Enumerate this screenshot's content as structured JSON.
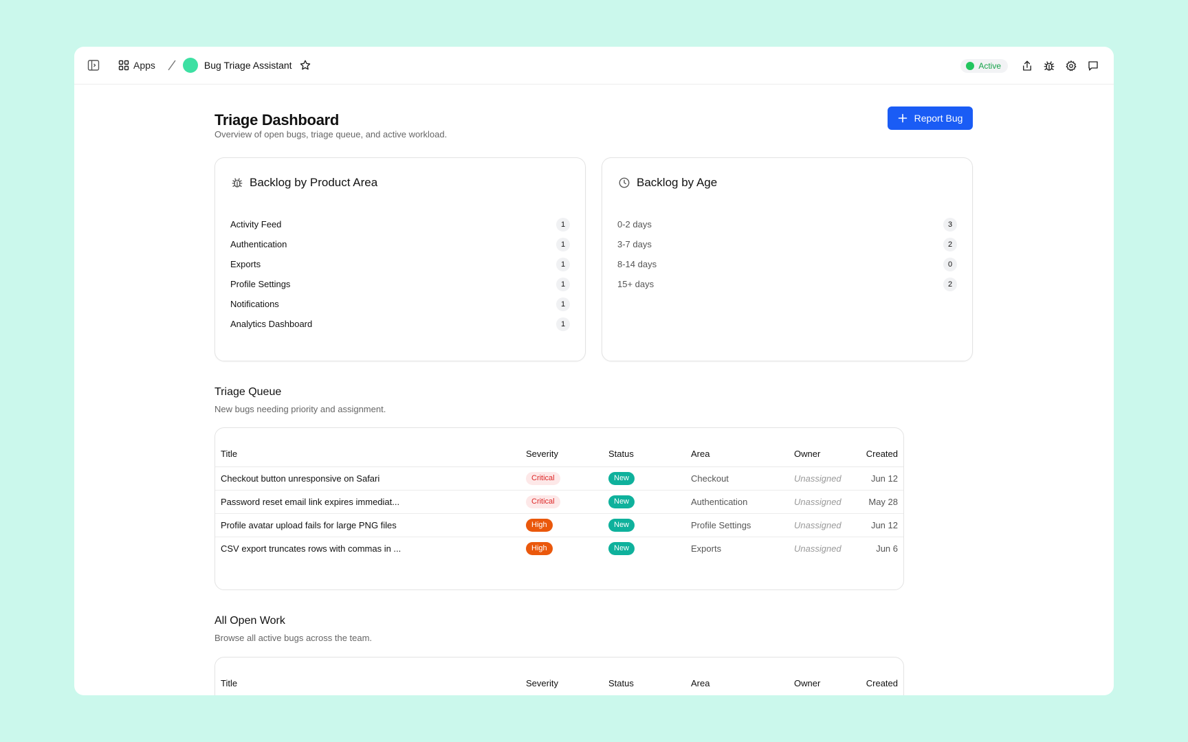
{
  "topbar": {
    "apps_label": "Apps",
    "app_name": "Bug Triage Assistant",
    "status_label": "Active"
  },
  "header": {
    "title": "Triage Dashboard",
    "subtitle": "Overview of open bugs, triage queue, and active workload.",
    "report_button": "Report Bug"
  },
  "backlog_area": {
    "title": "Backlog by Product Area",
    "items": [
      {
        "label": "Activity Feed",
        "count": "1"
      },
      {
        "label": "Authentication",
        "count": "1"
      },
      {
        "label": "Exports",
        "count": "1"
      },
      {
        "label": "Profile Settings",
        "count": "1"
      },
      {
        "label": "Notifications",
        "count": "1"
      },
      {
        "label": "Analytics Dashboard",
        "count": "1"
      }
    ]
  },
  "backlog_age": {
    "title": "Backlog by Age",
    "items": [
      {
        "label": "0-2 days",
        "count": "3"
      },
      {
        "label": "3-7 days",
        "count": "2"
      },
      {
        "label": "8-14 days",
        "count": "0"
      },
      {
        "label": "15+ days",
        "count": "2"
      }
    ]
  },
  "table_headers": {
    "title": "Title",
    "severity": "Severity",
    "status": "Status",
    "area": "Area",
    "owner": "Owner",
    "created": "Created"
  },
  "triage_queue": {
    "title": "Triage Queue",
    "subtitle": "New bugs needing priority and assignment.",
    "rows": [
      {
        "title": "Checkout button unresponsive on Safari",
        "severity": "Critical",
        "status": "New",
        "area": "Checkout",
        "owner": "Unassigned",
        "created": "Jun 12"
      },
      {
        "title": "Password reset email link expires immediat...",
        "severity": "Critical",
        "status": "New",
        "area": "Authentication",
        "owner": "Unassigned",
        "created": "May 28"
      },
      {
        "title": "Profile avatar upload fails for large PNG files",
        "severity": "High",
        "status": "New",
        "area": "Profile Settings",
        "owner": "Unassigned",
        "created": "Jun 12"
      },
      {
        "title": "CSV export truncates rows with commas in ...",
        "severity": "High",
        "status": "New",
        "area": "Exports",
        "owner": "Unassigned",
        "created": "Jun 6"
      }
    ]
  },
  "all_open": {
    "title": "All Open Work",
    "subtitle": "Browse all active bugs across the team."
  },
  "colors": {
    "background": "#cbf8ec",
    "accent": "#1a5cf5",
    "critical": "#dc2626",
    "high": "#ea580c",
    "new": "#0fb19c",
    "active": "#22c55e"
  }
}
